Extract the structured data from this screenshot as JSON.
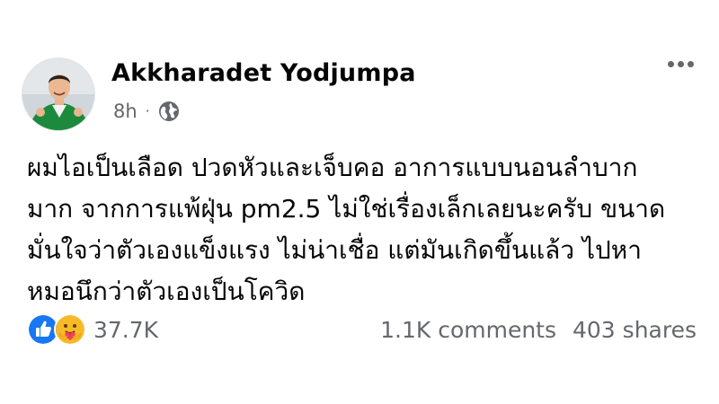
{
  "post": {
    "author": "Akkharadet Yodjumpa",
    "time": "8h",
    "separator": "·",
    "privacy_icon": "globe-icon",
    "more_icon": "more-options-icon",
    "text_lines": [
      "ผมไอเป็นเลือด ปวดหัวและเจ็บคอ อาการแบบนอนลำบาก",
      "มาก จากการแพ้ฝุ่น pm2.5 ไม่ใช่เรื่องเล็กเลยนะครับ ขนาด",
      "มั่นใจว่าตัวเองแข็งแรง ไม่น่าเชื่อ แต่มันเกิดขึ้นแล้ว ไปหา",
      "หมอนึกว่าตัวเองเป็นโควิด"
    ]
  },
  "footer": {
    "reaction_icons": [
      "like-icon",
      "care-icon"
    ],
    "reaction_count": "37.7K",
    "comments": "1.1K comments",
    "shares": "403 shares"
  },
  "colors": {
    "text": "#050505",
    "secondary": "#65676b",
    "like_blue": "#1877f2",
    "care_yellow": "#f7b928"
  }
}
